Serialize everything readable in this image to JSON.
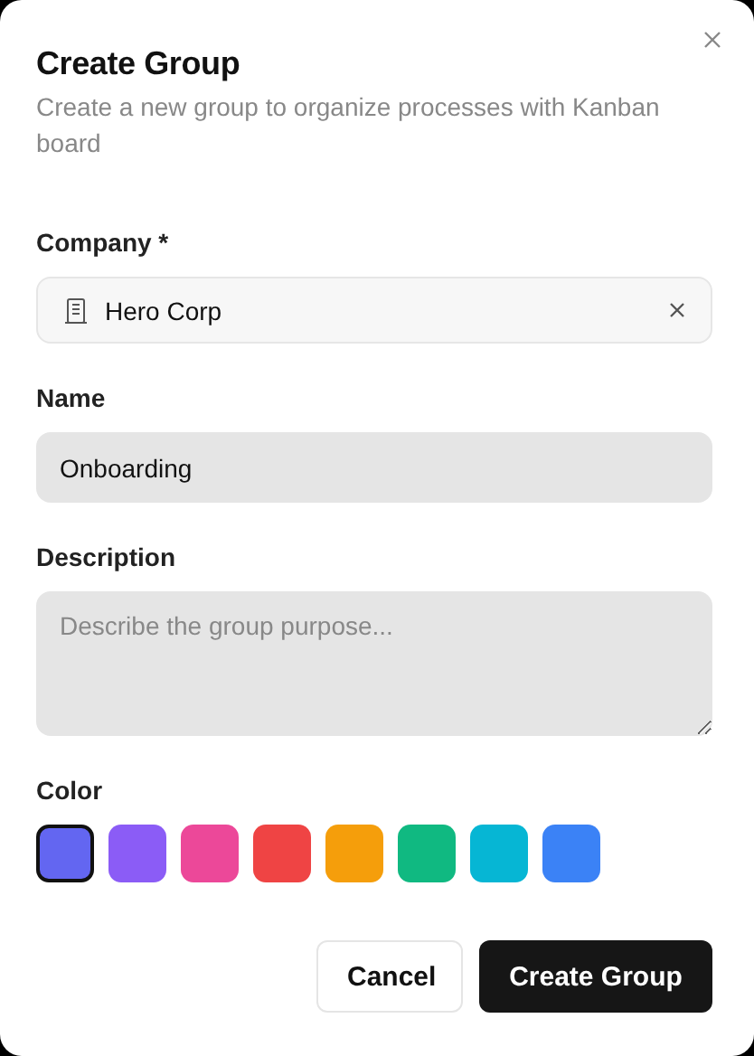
{
  "dialog": {
    "title": "Create Group",
    "subtitle": "Create a new group to organize processes with Kanban board"
  },
  "company": {
    "label": "Company *",
    "value": "Hero Corp"
  },
  "name": {
    "label": "Name",
    "value": "Onboarding"
  },
  "description": {
    "label": "Description",
    "placeholder": "Describe the group purpose..."
  },
  "color": {
    "label": "Color",
    "swatches": [
      {
        "color": "#6366f1",
        "selected": true
      },
      {
        "color": "#8b5cf6",
        "selected": false
      },
      {
        "color": "#ec4899",
        "selected": false
      },
      {
        "color": "#ef4444",
        "selected": false
      },
      {
        "color": "#f59e0b",
        "selected": false
      },
      {
        "color": "#10b981",
        "selected": false
      },
      {
        "color": "#06b6d4",
        "selected": false
      },
      {
        "color": "#3b82f6",
        "selected": false
      }
    ]
  },
  "buttons": [
    {
      "kind": "secondary",
      "label": "Cancel"
    },
    {
      "kind": "primary",
      "label": "Create Group"
    }
  ]
}
